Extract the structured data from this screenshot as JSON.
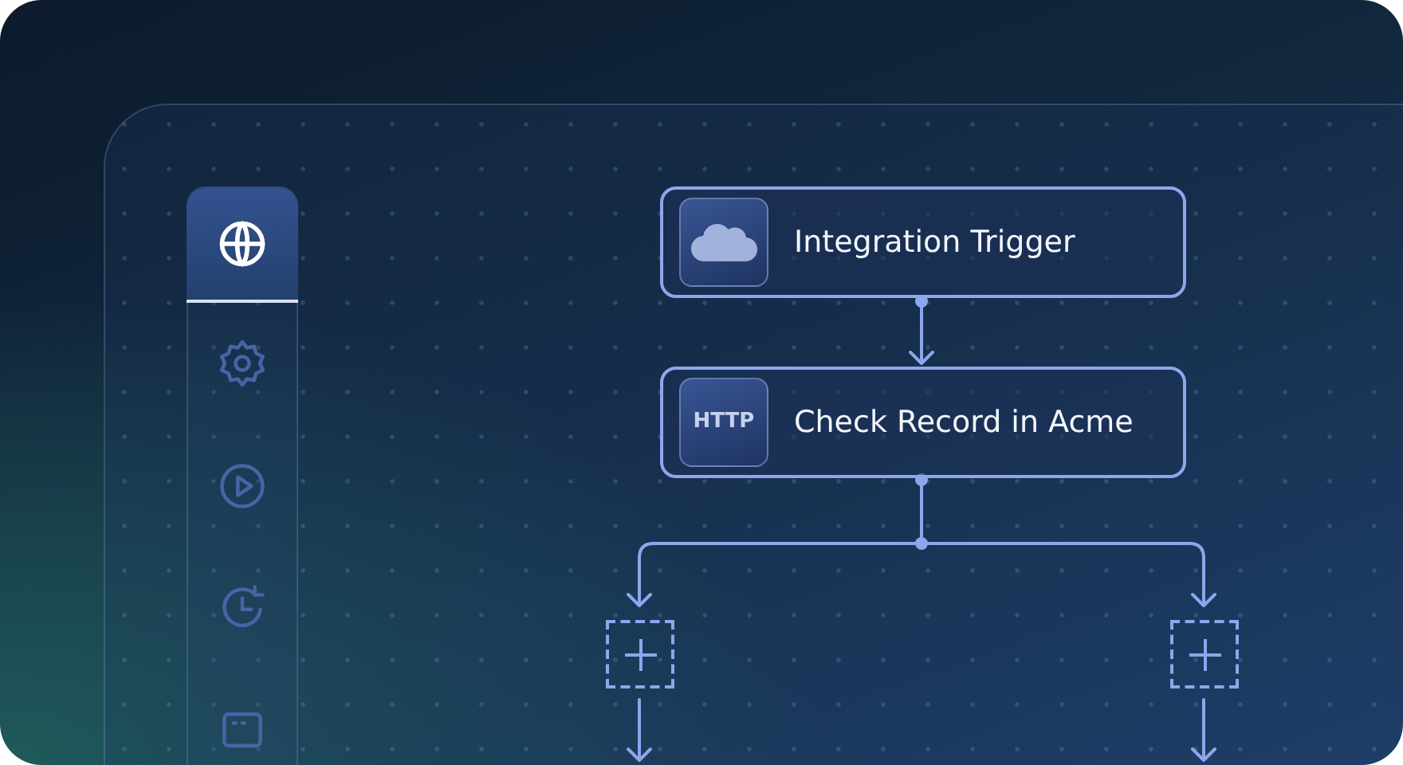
{
  "sidebar": {
    "items": [
      {
        "kind": "globe",
        "selected": true
      },
      {
        "kind": "gear",
        "selected": false
      },
      {
        "kind": "play",
        "selected": false
      },
      {
        "kind": "history",
        "selected": false
      },
      {
        "kind": "grid",
        "selected": false
      }
    ]
  },
  "flow": {
    "nodes": [
      {
        "kind": "cloud",
        "title": "Integration Trigger"
      },
      {
        "kind": "http",
        "badge": "HTTP",
        "title": "Check Record in Acme"
      }
    ]
  }
}
